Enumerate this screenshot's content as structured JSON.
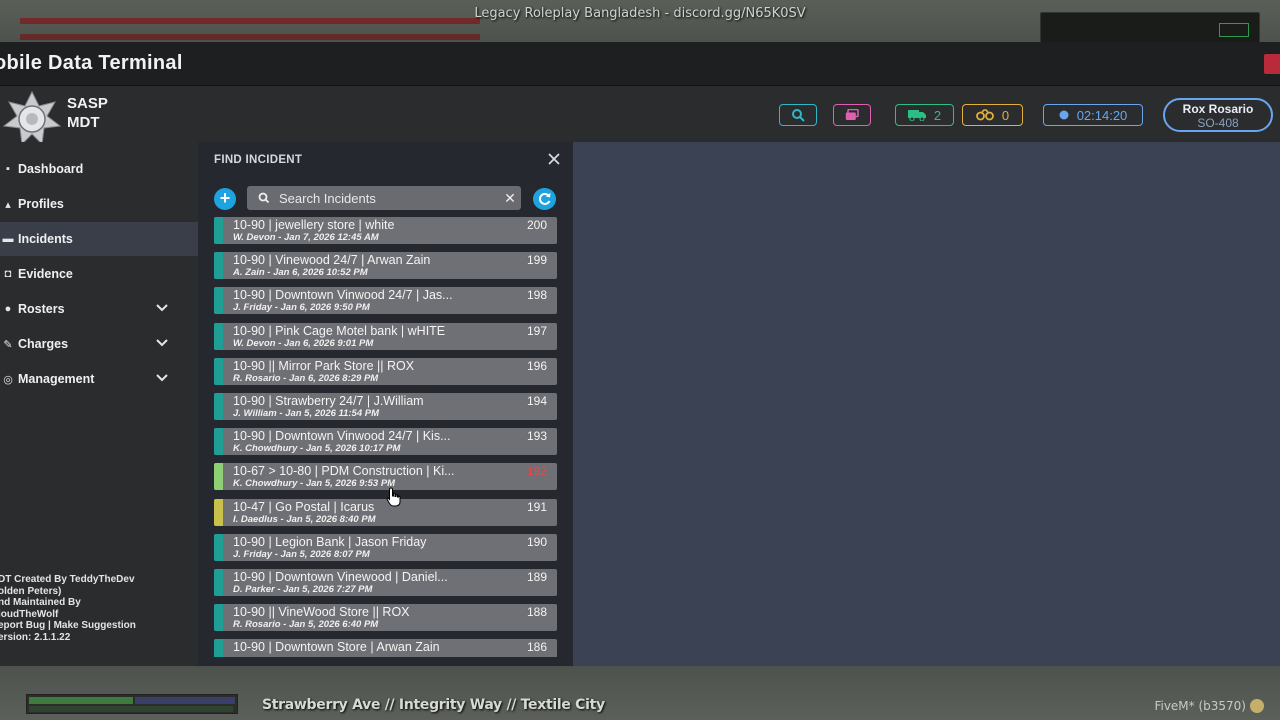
{
  "game": {
    "server_banner": "Legacy Roleplay Bangladesh - discord.gg/N65K0SV",
    "street": "Strawberry Ave // Integrity Way // Textile City",
    "client": "FiveM* (b3570)"
  },
  "window": {
    "title": "obile Data Terminal"
  },
  "brand": {
    "line1": "SASP",
    "line2": "MDT"
  },
  "header": {
    "ambulance_count": "2",
    "binoculars_count": "0",
    "clock": "02:14:20",
    "user_name": "Rox Rosario",
    "user_callsign": "SO-408"
  },
  "sidebar": {
    "items": [
      {
        "label": "Dashboard",
        "icon": "grid-icon"
      },
      {
        "label": "Profiles",
        "icon": "users-icon"
      },
      {
        "label": "Incidents",
        "icon": "folder-icon",
        "active": true
      },
      {
        "label": "Evidence",
        "icon": "evidence-icon"
      },
      {
        "label": "Rosters",
        "icon": "shield-icon",
        "expandable": true
      },
      {
        "label": "Charges",
        "icon": "gavel-icon",
        "expandable": true
      },
      {
        "label": "Management",
        "icon": "gear-icon",
        "expandable": true
      }
    ],
    "credits": [
      "DT Created By TeddyTheDev",
      "olden Peters)",
      "nd Maintained By",
      "loudTheWolf",
      "eport Bug | Make Suggestion",
      "ersion: 2.1.1.22"
    ]
  },
  "panel": {
    "title": "FIND INCIDENT",
    "search_placeholder": "Search Incidents"
  },
  "colors": {
    "teal": "#1f9e95",
    "green": "#8fcf74",
    "yellow": "#c9c24a",
    "accent": "#1fa3e0"
  },
  "incidents": [
    {
      "title": "10-90 | jewellery store | white",
      "meta": "W. Devon - Jan 7, 2026 12:45 AM",
      "id": "200",
      "color": "#1f9e95"
    },
    {
      "title": "10-90 | Vinewood 24/7 | Arwan Zain",
      "meta": "A. Zain - Jan 6, 2026 10:52 PM",
      "id": "199",
      "color": "#1f9e95"
    },
    {
      "title": "10-90 | Downtown Vinwood 24/7 | Jas...",
      "meta": "J. Friday - Jan 6, 2026 9:50 PM",
      "id": "198",
      "color": "#1f9e95"
    },
    {
      "title": "10-90 | Pink Cage Motel bank | wHITE",
      "meta": "W. Devon - Jan 6, 2026 9:01 PM",
      "id": "197",
      "color": "#1f9e95"
    },
    {
      "title": "10-90 || Mirror Park Store || ROX",
      "meta": "R. Rosario - Jan 6, 2026 8:29 PM",
      "id": "196",
      "color": "#1f9e95"
    },
    {
      "title": "10-90 | Strawberry 24/7 | J.William",
      "meta": "J. William - Jan 5, 2026 11:54 PM",
      "id": "194",
      "color": "#1f9e95"
    },
    {
      "title": "10-90 | Downtown Vinwood 24/7 | Kis...",
      "meta": "K. Chowdhury - Jan 5, 2026 10:17 PM",
      "id": "193",
      "color": "#1f9e95"
    },
    {
      "title": "10-67 > 10-80 | PDM Construction | Ki...",
      "meta": "K. Chowdhury - Jan 5, 2026 9:53 PM",
      "id": "192",
      "color": "#8fcf74",
      "id_red": true
    },
    {
      "title": "10-47 | Go Postal | Icarus",
      "meta": "I. Daedlus - Jan 5, 2026 8:40 PM",
      "id": "191",
      "color": "#c9c24a"
    },
    {
      "title": "10-90 | Legion Bank | Jason Friday",
      "meta": "J. Friday - Jan 5, 2026 8:07 PM",
      "id": "190",
      "color": "#1f9e95"
    },
    {
      "title": "10-90 | Downtown Vinewood | Daniel...",
      "meta": "D. Parker - Jan 5, 2026 7:27 PM",
      "id": "189",
      "color": "#1f9e95"
    },
    {
      "title": "10-90 || VineWood Store || ROX",
      "meta": "R. Rosario - Jan 5, 2026 6:40 PM",
      "id": "188",
      "color": "#1f9e95"
    },
    {
      "title": "10-90 | Downtown Store | Arwan Zain",
      "meta": "",
      "id": "186",
      "color": "#1f9e95"
    }
  ]
}
